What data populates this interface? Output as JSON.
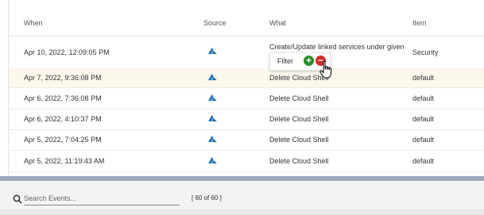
{
  "columns": {
    "when": "When",
    "source": "Source",
    "what": "What",
    "item": "Item"
  },
  "rows": [
    {
      "when": "Apr 10, 2022, 12:09:05 PM",
      "source": "azure-icon",
      "what": "Create/Update linked services under given",
      "item": "Security"
    },
    {
      "when": "Apr 7, 2022, 9:36:08 PM",
      "source": "azure-icon",
      "what": "Delete Cloud Shell",
      "item": "default"
    },
    {
      "when": "Apr 6, 2022, 7:36:08 PM",
      "source": "azure-icon",
      "what": "Delete Cloud Shell",
      "item": "default"
    },
    {
      "when": "Apr 6, 2022, 4:10:37 PM",
      "source": "azure-icon",
      "what": "Delete Cloud Shell",
      "item": "default"
    },
    {
      "when": "Apr 5, 2022, 7:04:25 PM",
      "source": "azure-icon",
      "what": "Delete Cloud Shell",
      "item": "default"
    },
    {
      "when": "Apr 5, 2022, 11:19:43 AM",
      "source": "azure-icon",
      "what": "Delete Cloud Shell",
      "item": "default"
    }
  ],
  "filter_popup": {
    "label": "Filter",
    "add_icon": "plus-circle-icon",
    "remove_icon": "minus-circle-icon"
  },
  "search": {
    "placeholder": "Search Events...",
    "value": ""
  },
  "counter": "[ 60 of 60 ]",
  "colors": {
    "highlight_row": "#fcf8ec",
    "azure_blue": "#1f6fb5",
    "plus_green": "#2a8a2a",
    "minus_red": "#d42a2a",
    "scrollbar": "#9aa9b8"
  }
}
